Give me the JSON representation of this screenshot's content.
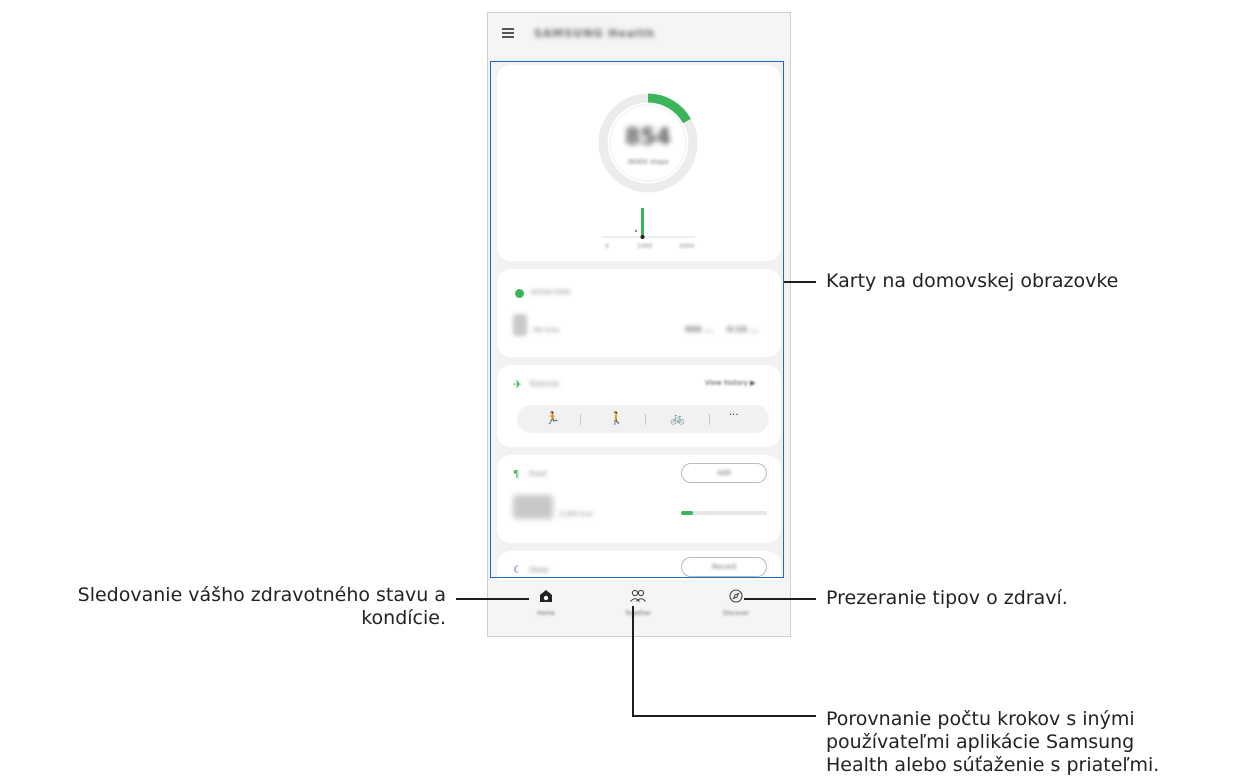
{
  "app": {
    "title": "SAMSUNG Health",
    "menu_icon": "hamburger-menu-icon"
  },
  "steps_card": {
    "count": "854",
    "goal": "/6000 steps",
    "chart_labels": [
      "0",
      "1000",
      "2000"
    ],
    "progress_fraction": 0.14,
    "accent_color": "#3cb55a"
  },
  "active_time_card": {
    "title": "Active time",
    "value": "8",
    "unit": "/90 mins",
    "stats": [
      "000 ...",
      "0:10 ..."
    ]
  },
  "exercise_card": {
    "title": "Exercise",
    "link": "View history ▶",
    "activities": [
      "running-icon",
      "walking-icon",
      "cycling-icon",
      "more-icon"
    ],
    "more_label": "···"
  },
  "food_card": {
    "title": "Food",
    "button": "Add",
    "value": "0",
    "unit": "/1,850 kcal",
    "progress_fraction": 0.05
  },
  "sleep_card": {
    "title": "Sleep",
    "button": "Record"
  },
  "nav": {
    "home": "Home",
    "together": "Together",
    "discover": "Discover"
  },
  "callouts": {
    "cards": "Karty na domovskej obrazovke",
    "home_line1": "Sledovanie vášho zdravotného stavu a",
    "home_line2": "kondície.",
    "discover": "Prezeranie tipov o zdraví.",
    "together_line1": "Porovnanie počtu krokov s inými",
    "together_line2": "používateľmi aplikácie Samsung",
    "together_line3": "Health alebo súťaženie s priateľmi."
  },
  "colors": {
    "highlight": "#1e6cc8",
    "accent_green": "#3cb55a"
  }
}
